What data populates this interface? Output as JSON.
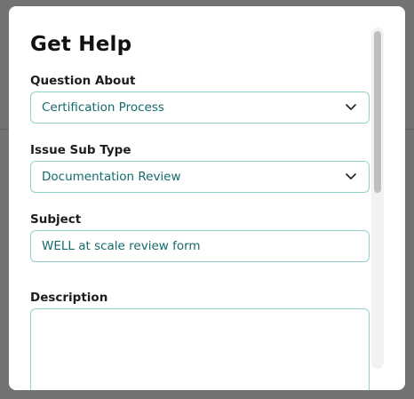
{
  "modal": {
    "title": "Get Help",
    "question_about": {
      "label": "Question About",
      "value": "Certification Process"
    },
    "issue_sub_type": {
      "label": "Issue Sub Type",
      "value": "Documentation Review"
    },
    "subject": {
      "label": "Subject",
      "value": "WELL at scale review form"
    },
    "description": {
      "label": "Description",
      "value": ""
    }
  },
  "colors": {
    "accent_text": "#136b6b",
    "input_border": "#8fd3cc",
    "overlay": "#000000"
  },
  "icons": {
    "select_chevron": "chevron-down-icon"
  }
}
